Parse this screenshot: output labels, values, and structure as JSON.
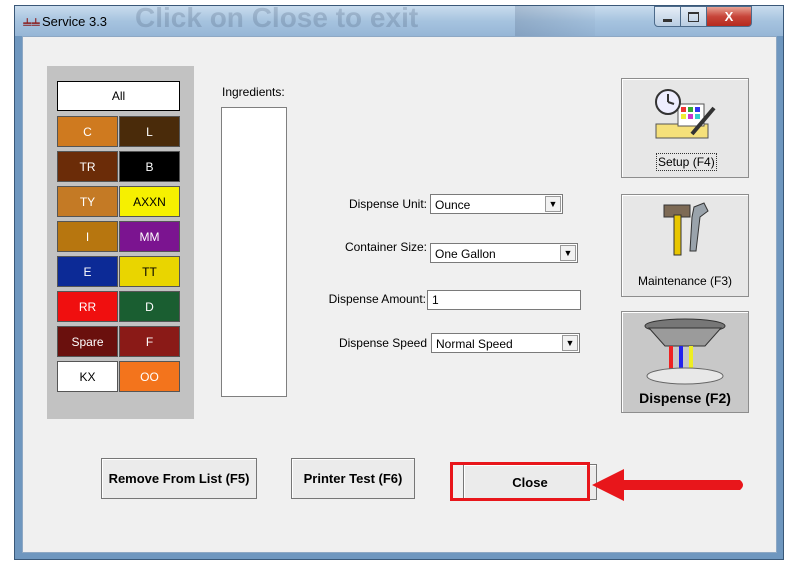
{
  "window": {
    "title": "Service 3.3",
    "app_icon": "app-logo-icon",
    "controls": {
      "minimize": "minimize-icon",
      "maximize": "maximize-icon",
      "close": "close-icon",
      "close_glyph": "X"
    }
  },
  "palette": {
    "all_label": "All",
    "cells": [
      {
        "label": "C",
        "bg": "#cf7a1f",
        "fg": "#ffffff"
      },
      {
        "label": "L",
        "bg": "#4a2b0a",
        "fg": "#ffffff"
      },
      {
        "label": "TR",
        "bg": "#6b2c08",
        "fg": "#ffffff"
      },
      {
        "label": "B",
        "bg": "#000000",
        "fg": "#ffffff"
      },
      {
        "label": "TY",
        "bg": "#c47a25",
        "fg": "#ffffff"
      },
      {
        "label": "AXXN",
        "bg": "#f6f000",
        "fg": "#000000"
      },
      {
        "label": "I",
        "bg": "#b7760f",
        "fg": "#ffffff"
      },
      {
        "label": "MM",
        "bg": "#7b1490",
        "fg": "#ffffff"
      },
      {
        "label": "E",
        "bg": "#0c2a96",
        "fg": "#ffffff"
      },
      {
        "label": "TT",
        "bg": "#e9d500",
        "fg": "#000000"
      },
      {
        "label": "RR",
        "bg": "#f00f0f",
        "fg": "#ffffff"
      },
      {
        "label": "D",
        "bg": "#1a5e31",
        "fg": "#ffffff"
      },
      {
        "label": "Spare",
        "bg": "#6a100d",
        "fg": "#ffffff"
      },
      {
        "label": "F",
        "bg": "#8a1a17",
        "fg": "#ffffff"
      },
      {
        "label": "KX",
        "bg": "#ffffff",
        "fg": "#000000"
      },
      {
        "label": "OO",
        "bg": "#f3741c",
        "fg": "#ffffff"
      }
    ]
  },
  "ingredients": {
    "label": "Ingredients:"
  },
  "form": {
    "dispense_unit": {
      "label": "Dispense Unit:",
      "value": "Ounce"
    },
    "container_size": {
      "label": "Container Size:",
      "value": "One Gallon"
    },
    "dispense_amount": {
      "label": "Dispense Amount:",
      "value": "1"
    },
    "dispense_speed": {
      "label": "Dispense Speed",
      "value": "Normal Speed"
    }
  },
  "side_buttons": {
    "setup": {
      "label": "Setup (F4)",
      "icon": "setup-clock-ruler-icon"
    },
    "maintenance": {
      "label": "Maintenance (F3)",
      "icon": "hammer-wrench-icon"
    },
    "dispense": {
      "label": "Dispense (F2)",
      "icon": "dispenser-icon"
    }
  },
  "bottom_buttons": {
    "remove": "Remove From List (F5)",
    "printer_test": "Printer Test (F6)",
    "close": "Close"
  },
  "annotation": {
    "arrow_color": "#e8161b",
    "highlight_color": "#e8161b"
  }
}
